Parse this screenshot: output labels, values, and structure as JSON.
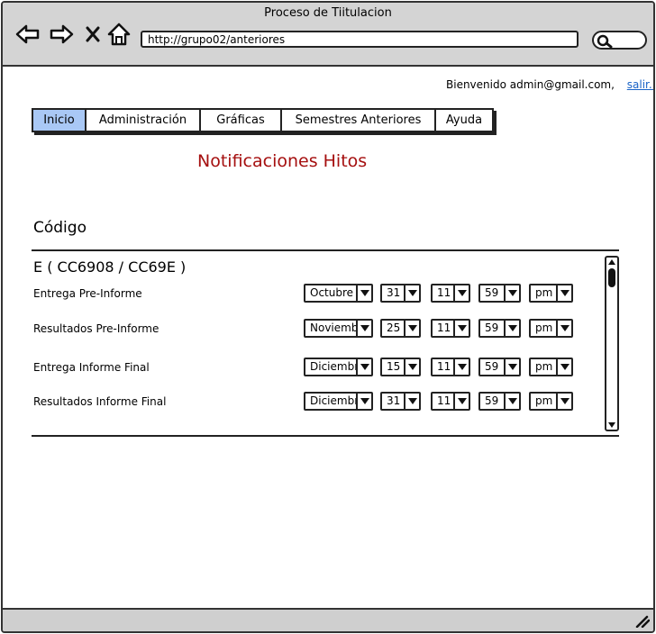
{
  "window": {
    "title": "Proceso de Tiitulacion",
    "url": "http://grupo02/anteriores"
  },
  "header": {
    "welcome_text": "Bienvenido admin@gmail.com,",
    "logout_label": "salir..."
  },
  "tabs": [
    {
      "label": "Inicio",
      "active": true
    },
    {
      "label": "Administración",
      "active": false
    },
    {
      "label": "Gráficas",
      "active": false
    },
    {
      "label": "Semestres Anteriores",
      "active": false
    },
    {
      "label": "Ayuda",
      "active": false
    }
  ],
  "main": {
    "heading": "Notificaciones Hitos",
    "code_label": "Código",
    "group_title": "E ( CC6908 / CC69E )",
    "rows": [
      {
        "label": "Entrega Pre-Informe",
        "month": "Octubre",
        "day": "31",
        "hour": "11",
        "minute": "59",
        "ampm": "pm"
      },
      {
        "label": "Resultados Pre-Informe",
        "month": "Noviembre",
        "day": "25",
        "hour": "11",
        "minute": "59",
        "ampm": "pm"
      },
      {
        "label": "Entrega Informe Final",
        "month": "Diciembre",
        "day": "15",
        "hour": "11",
        "minute": "59",
        "ampm": "pm"
      },
      {
        "label": "Resultados Informe Final",
        "month": "Diciembre",
        "day": "31",
        "hour": "11",
        "minute": "59",
        "ampm": "pm"
      }
    ]
  },
  "colors": {
    "titlebar": "#d4d4d4",
    "active_tab": "#a9c8f5",
    "heading": "#a50f0f",
    "link": "#1a63c7"
  },
  "icons": [
    "back-arrow-icon",
    "forward-arrow-icon",
    "close-icon",
    "home-icon",
    "search-icon",
    "resize-grip-icon",
    "chevron-down-icon"
  ]
}
